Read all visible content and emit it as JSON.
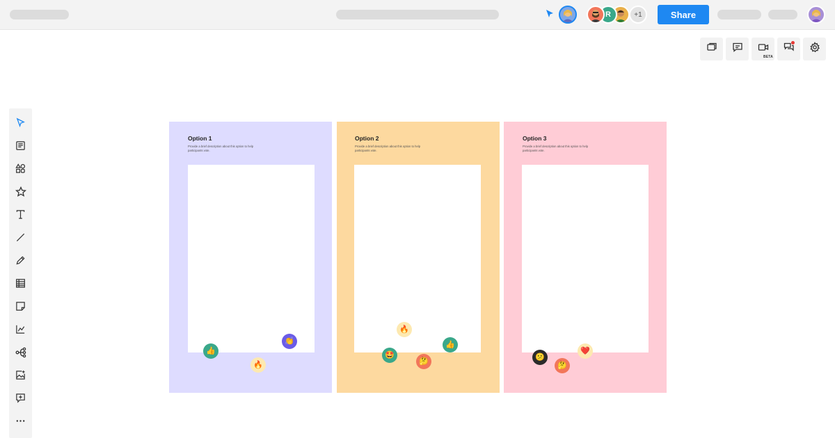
{
  "header": {
    "share_label": "Share",
    "collaborators_overflow": "+1",
    "collaborator_initial": "R"
  },
  "toolbar_right": {
    "beta_label": "BETA",
    "items": [
      "frames",
      "comments",
      "video",
      "chat",
      "settings"
    ]
  },
  "sidebar": {
    "items": [
      "select",
      "templates",
      "shapes",
      "favorites",
      "text",
      "line",
      "pen",
      "table",
      "sticky-note",
      "chart",
      "mindmap",
      "upload",
      "add-frame",
      "more"
    ]
  },
  "boards": [
    {
      "title": "Option 1",
      "description": "Provide a brief description about this option to help participants vote.",
      "color": "#dedcff",
      "reactions": [
        "👍",
        "👏",
        "🔥"
      ]
    },
    {
      "title": "Option 2",
      "description": "Provide a brief description about this option to help participants vote.",
      "color": "#fdd99f",
      "reactions": [
        "🔥",
        "🤩",
        "🤔",
        "👍"
      ]
    },
    {
      "title": "Option 3",
      "description": "Provide a brief description about this option to help participants vote.",
      "color": "#ffccd6",
      "reactions": [
        "😕",
        "🤔",
        "❤️"
      ]
    }
  ],
  "colors": {
    "accent": "#1e88f2",
    "topbar": "#f3f3f3"
  }
}
